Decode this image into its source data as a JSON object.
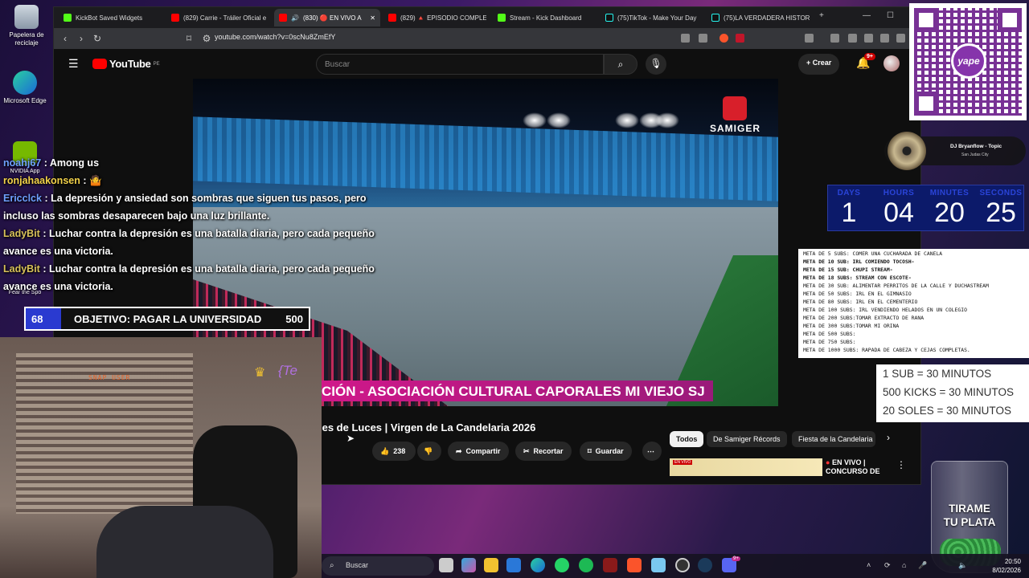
{
  "desktop": {
    "icons": [
      {
        "label": "Papelera de reciclaje"
      },
      {
        "label": "Microsoft Edge"
      },
      {
        "label": "NVIDIA App"
      },
      {
        "label": "Fear the Spo"
      }
    ]
  },
  "browser": {
    "tabs": [
      {
        "label": "KickBot Saved Widgets",
        "color": "#53fc18"
      },
      {
        "label": "(829) Carrie - Tráiler Oficial e",
        "color": "#ff0000"
      },
      {
        "label": "(830) 🔴 EN VIVO A",
        "color": "#ff0000"
      },
      {
        "label": "(829) 🔺 EPISODIO COMPLE",
        "color": "#ff0000"
      },
      {
        "label": "Stream - Kick Dashboard",
        "color": "#53fc18"
      },
      {
        "label": "(75)TikTok - Make Your Day",
        "color": "#111111"
      },
      {
        "label": "(75)LA VERDADERA HISTORI",
        "color": "#111111"
      }
    ],
    "url": "youtube.com/watch?v=0scNu8ZmEfY"
  },
  "youtube": {
    "logo": "YouTube",
    "region": "PE",
    "search_placeholder": "Buscar",
    "create_label": "Crear",
    "notif_count": "9+",
    "video_title": "jes de Luces | Virgen de La Candelaria 2026",
    "like_count": "238",
    "share_label": "Compartir",
    "clip_label": "Recortar",
    "save_label": "Guardar",
    "chips": [
      "Todos",
      "De Samiger Récords",
      "Fiesta de la Candelaria"
    ],
    "rec_live_label": "EN VIVO |",
    "rec_live_sub": "CONCURSO DE",
    "rec_thumb_badge": "EN VIVO"
  },
  "video": {
    "brand": "SAMIGER",
    "lower_third": "CIÓN - ASOCIACIÓN CULTURAL CAPORALES MI VIEJO SJ"
  },
  "chat": [
    {
      "user": "noahj67",
      "text": "Among us"
    },
    {
      "user": "ronjahaakonsen",
      "text": "🤷"
    },
    {
      "user": "Ericclck",
      "text": "La depresión y ansiedad son sombras que siguen tus pasos, pero incluso las sombras desaparecen bajo una luz brillante."
    },
    {
      "user": "LadyBit",
      "text": "Luchar contra la depresión es una batalla diaria, pero cada pequeño avance es una victoria."
    },
    {
      "user": "LadyBit",
      "text": "Luchar contra la depresión es una batalla diaria, pero cada pequeño avance es una victoria."
    }
  ],
  "objective": {
    "current": "68",
    "label": "OBJETIVO: PAGAR LA UNIVERSIDAD",
    "target": "500",
    "fill_color": "#2a3ad0"
  },
  "webcam": {
    "snap_user": "SNAP USER",
    "overlay_text": "{Te"
  },
  "now_playing": {
    "title": "DJ Bryanflow - Topic",
    "subtitle": "San Judas City"
  },
  "countdown": {
    "labels": [
      "DAYS",
      "HOURS",
      "MINUTES",
      "SECONDS"
    ],
    "values": [
      "1",
      "04",
      "20",
      "25"
    ]
  },
  "metas": [
    {
      "text": "META DE 5 SUBS: COMER UNA CUCHARADA DE CANELA",
      "bold": false
    },
    {
      "text": "META DE 10 SUB: IRL COMIENDO TOCOSH-",
      "bold": true
    },
    {
      "text": "META DE 15 SUB: CHUPI STREAM-",
      "bold": true
    },
    {
      "text": "META DE 18 SUBS: STREAM CON ESCOTE-",
      "bold": true
    },
    {
      "text": "META DE 30 SUB:  ALIMENTAR PERRITOS DE LA CALLE Y DUCHASTREAM",
      "bold": false
    },
    {
      "text": "META DE 50 SUBS: IRL EN EL GIMNASIO",
      "bold": false
    },
    {
      "text": "META DE 80 SUBS: IRL EN EL CEMENTERIO",
      "bold": false
    },
    {
      "text": "META DE 100 SUBS: IRL VENDIENDO HELADOS EN UN COLEGIO",
      "bold": false
    },
    {
      "text": "META DE 200 SUBS:TOMAR EXTRACTO DE RANA",
      "bold": false
    },
    {
      "text": "META DE 300 SUBS:TOMAR MI ORINA",
      "bold": false
    },
    {
      "text": "META DE 500 SUBS:",
      "bold": false
    },
    {
      "text": "META DE 750 SUBS:",
      "bold": false
    },
    {
      "text": "META DE 1000 SUBS: RAPADA DE CABEZA Y CEJAS COMPLETAS.",
      "bold": false
    }
  ],
  "rates": [
    "1 SUB = 30 MINUTOS",
    "500 KICKS = 30 MINUTOS",
    "20 SOLES = 30 MINUTOS"
  ],
  "jar": {
    "line1": "TIRAME",
    "line2": "TU PLATA"
  },
  "qr": {
    "brand": "yape"
  },
  "taskbar": {
    "search_label": "Buscar",
    "time": "20:50",
    "date": "8/02/2026",
    "discord_badge": "9+"
  }
}
